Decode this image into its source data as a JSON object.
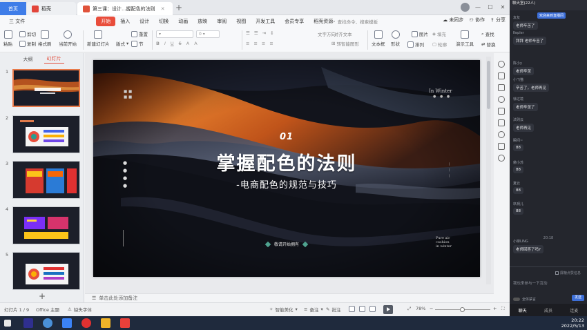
{
  "tabs": {
    "home": "首页",
    "docer": "稻壳",
    "doc": "第三课：设计...握配色的法则"
  },
  "menubar": {
    "file": "三 文件",
    "items": [
      "开始",
      "插入",
      "设计",
      "切换",
      "动画",
      "放映",
      "审阅",
      "视图",
      "开发工具",
      "会员专享",
      "稻壳资源"
    ],
    "search_placeholder": "查找命令、搜索模板",
    "sync": "未同步",
    "collab": "协作",
    "share": "分享"
  },
  "ribbon": {
    "paste": "粘贴",
    "cut": "剪切",
    "copy": "复制",
    "format_painter": "格式刷",
    "play_from_current": "当前开始",
    "new_slide": "新建幻灯片",
    "layout": "版式",
    "section": "节",
    "reset": "重置",
    "text_direction": "文字方向",
    "align_text": "对齐文本",
    "smartart": "转智能图形",
    "textbox": "文本框",
    "shape": "形状",
    "arrange": "排列",
    "picture": "图片",
    "fill": "填充",
    "outline": "轮廓",
    "find": "查找",
    "presenter": "演示工具",
    "replace": "替换"
  },
  "leftpanel": {
    "tab_outline": "大纲",
    "tab_slides": "幻灯片",
    "slide_numbers": [
      "1",
      "2",
      "3",
      "4",
      "5"
    ]
  },
  "slide": {
    "number": "01",
    "title": "掌握配色的法则",
    "subtitle": "-电商配色的规范与技巧",
    "top_right": "In Winter",
    "motto": "敬请开始拥有",
    "corner_text": "Pure air\ncushion\nin winter"
  },
  "notes_placeholder": "单击此处添加备注",
  "statusbar": {
    "slide_count": "幻灯片 1 / 9",
    "theme": "Office 主题",
    "missing_font": "缺失字体",
    "smart_beautify": "智能美化",
    "notes": "备注",
    "comments": "批注",
    "zoom": "78%"
  },
  "chat": {
    "header": "聊天室(22人)",
    "tip": "欢迎来到直播间",
    "messages": [
      {
        "name": "友友",
        "text": "老师辛苦了"
      },
      {
        "name": "Kepler",
        "text": "拜拜 老师辛苦了"
      },
      {
        "name": "陈小y",
        "text": "老师辛苦"
      },
      {
        "name": "小飞猫",
        "text": "辛苦了，老师再见"
      },
      {
        "name": "徐过境",
        "text": "老师辛苦了"
      },
      {
        "name": "法则云",
        "text": "老师再见"
      },
      {
        "name": "瞬间~",
        "text": "88"
      },
      {
        "name": "傲小苏",
        "text": "88"
      },
      {
        "name": "夏云",
        "text": "88"
      },
      {
        "name": "玖玥儿",
        "text": "88"
      },
      {
        "name": "小柳LING",
        "text": "老师回答了吗?"
      }
    ],
    "time": "20:18",
    "privacy": "屏蔽点赞信息",
    "input_placeholder": "我也来参与一下互动",
    "mute": "全体禁言",
    "send": "发送",
    "tab_chat": "聊天",
    "tab_members": "成员",
    "tab_mic": "连麦"
  },
  "clock": {
    "time": "20:22",
    "date": "2022/5/13"
  },
  "colors": {
    "accent": "#e94d3b",
    "home_tab": "#3f7de8",
    "chat_bg": "#24262d"
  }
}
